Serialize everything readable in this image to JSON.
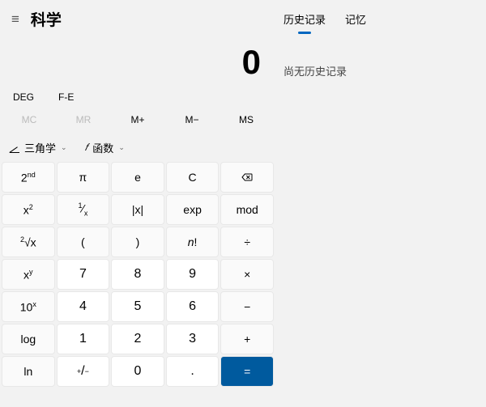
{
  "title": "科学",
  "display": "0",
  "mode": {
    "deg": "DEG",
    "fe": "F-E"
  },
  "memory": {
    "mc": "MC",
    "mr": "MR",
    "mplus": "M+",
    "mminus": "M−",
    "ms": "MS"
  },
  "funcs": {
    "trig": "三角学",
    "fn_symbol": "𝑓",
    "fn_label": "函数"
  },
  "buttons": {
    "r0": [
      "2ⁿᵈ",
      "π",
      "e",
      "C",
      "⌫"
    ],
    "r1": [
      "x²",
      "¹⁄ₓ",
      "|x|",
      "exp",
      "mod"
    ],
    "r2": [
      "²√x",
      "(",
      ")",
      "n!",
      "÷"
    ],
    "r3": [
      "xʸ",
      "7",
      "8",
      "9",
      "×"
    ],
    "r4": [
      "10ˣ",
      "4",
      "5",
      "6",
      "−"
    ],
    "r5": [
      "log",
      "1",
      "2",
      "3",
      "+"
    ],
    "r6": [
      "ln",
      "+/−",
      "0",
      ".",
      "="
    ]
  },
  "tabs": {
    "history": "历史记录",
    "memory": "记忆"
  },
  "empty_history": "尚无历史记录"
}
